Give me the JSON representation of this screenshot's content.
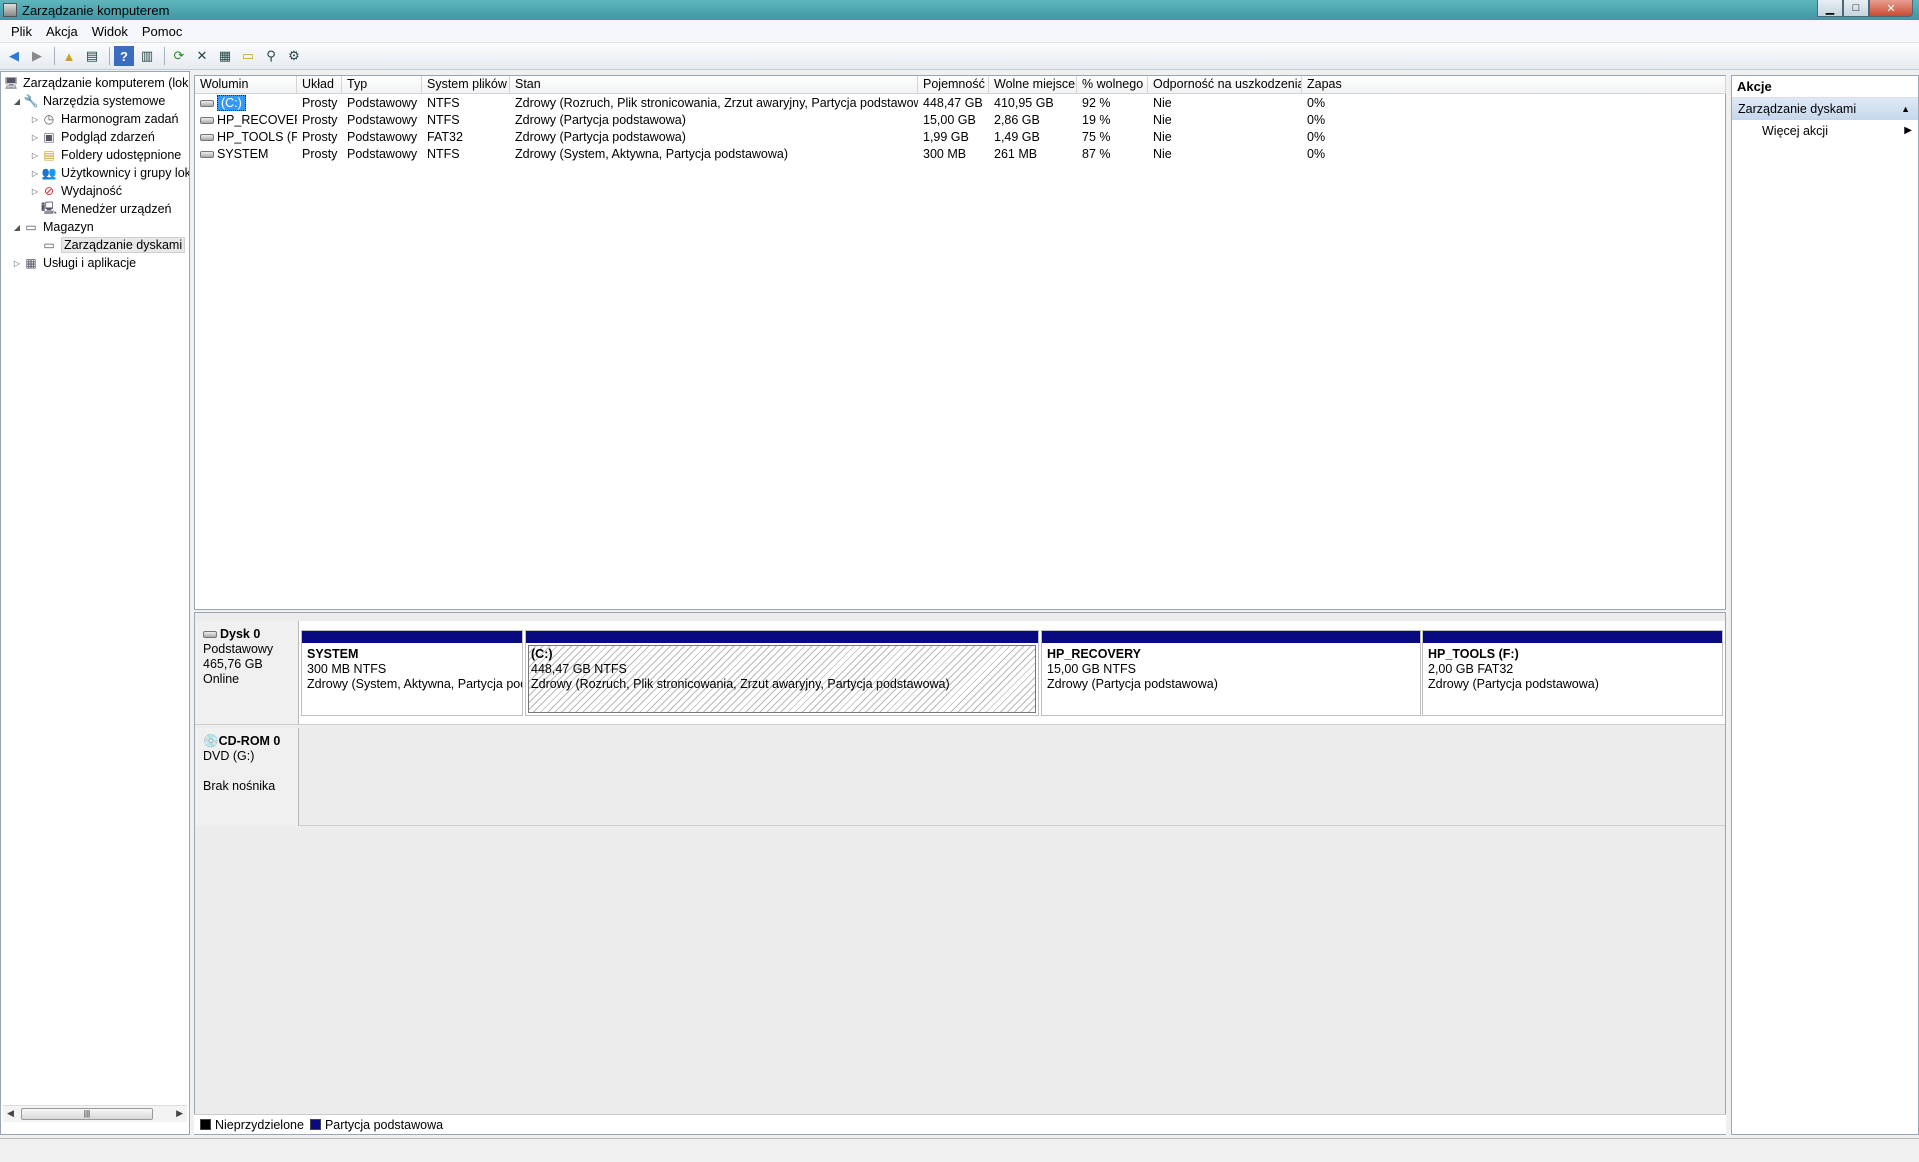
{
  "window": {
    "title": "Zarządzanie komputerem"
  },
  "menu": [
    "Plik",
    "Akcja",
    "Widok",
    "Pomoc"
  ],
  "tree": {
    "root": "Zarządzanie komputerem (lokalny)",
    "system_tools": "Narzędzia systemowe",
    "task_scheduler": "Harmonogram zadań",
    "event_viewer": "Podgląd zdarzeń",
    "shared_folders": "Foldery udostępnione",
    "users_groups": "Użytkownicy i grupy lokalne",
    "performance": "Wydajność",
    "device_manager": "Menedżer urządzeń",
    "storage": "Magazyn",
    "disk_management": "Zarządzanie dyskami",
    "services_apps": "Usługi i aplikacje"
  },
  "volumes": {
    "columns": [
      "Wolumin",
      "Układ",
      "Typ",
      "System plików",
      "Stan",
      "Pojemność",
      "Wolne miejsce",
      "% wolnego",
      "Odporność na uszkodzenia",
      "Zapas"
    ],
    "rows": [
      [
        "(C:)",
        "Prosty",
        "Podstawowy",
        "NTFS",
        "Zdrowy (Rozruch, Plik stronicowania, Zrzut awaryjny, Partycja podstawowa)",
        "448,47 GB",
        "410,95 GB",
        "92 %",
        "Nie",
        "0%"
      ],
      [
        "HP_RECOVERY",
        "Prosty",
        "Podstawowy",
        "NTFS",
        "Zdrowy (Partycja podstawowa)",
        "15,00 GB",
        "2,86 GB",
        "19 %",
        "Nie",
        "0%"
      ],
      [
        "HP_TOOLS (F:)",
        "Prosty",
        "Podstawowy",
        "FAT32",
        "Zdrowy (Partycja podstawowa)",
        "1,99 GB",
        "1,49 GB",
        "75 %",
        "Nie",
        "0%"
      ],
      [
        "SYSTEM",
        "Prosty",
        "Podstawowy",
        "NTFS",
        "Zdrowy (System, Aktywna, Partycja podstawowa)",
        "300 MB",
        "261 MB",
        "87 %",
        "Nie",
        "0%"
      ]
    ]
  },
  "disk0": {
    "name": "Dysk 0",
    "type": "Podstawowy",
    "size": "465,76 GB",
    "status": "Online",
    "partitions": [
      {
        "name": "SYSTEM",
        "size": "300 MB NTFS",
        "status": "Zdrowy (System, Aktywna, Partycja pod"
      },
      {
        "name": "(C:)",
        "size": "448,47 GB NTFS",
        "status": "Zdrowy (Rozruch, Plik stronicowania, Zrzut awaryjny, Partycja podstawowa)"
      },
      {
        "name": "HP_RECOVERY",
        "size": "15,00 GB NTFS",
        "status": "Zdrowy (Partycja podstawowa)"
      },
      {
        "name": "HP_TOOLS  (F:)",
        "size": "2,00 GB FAT32",
        "status": "Zdrowy (Partycja podstawowa)"
      }
    ]
  },
  "cdrom0": {
    "name": "CD-ROM 0",
    "type": "DVD (G:)",
    "status": "Brak nośnika"
  },
  "legend": {
    "unallocated": "Nieprzydzielone",
    "primary": "Partycja podstawowa",
    "unallocated_color": "#000000",
    "primary_color": "#0a0a80"
  },
  "actions": {
    "header": "Akcje",
    "section": "Zarządzanie dyskami",
    "more": "Więcej akcji"
  }
}
